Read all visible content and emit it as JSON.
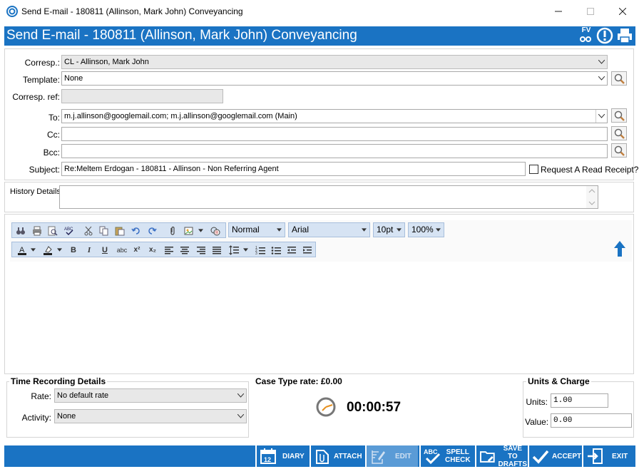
{
  "window": {
    "title": "Send E-mail - 180811 (Allinson, Mark John) Conveyancing",
    "minimize_icon": "minimize-icon",
    "maximize_icon": "maximize-icon",
    "close_icon": "close-icon"
  },
  "header": {
    "title": "Send E-mail - 180811 (Allinson, Mark John) Conveyancing",
    "fv_label": "FV",
    "accent": "#1a73c3"
  },
  "form": {
    "corresp_label": "Corresp.:",
    "corresp_value": "CL - Allinson, Mark John",
    "template_label": "Template:",
    "template_value": "None",
    "corresp_ref_label": "Corresp. ref:",
    "corresp_ref_value": "",
    "to_label": "To:",
    "to_value": "m.j.allinson@googlemail.com; m.j.allinson@googlemail.com (Main)",
    "cc_label": "Cc:",
    "cc_value": "",
    "bcc_label": "Bcc:",
    "bcc_value": "",
    "subject_label": "Subject:",
    "subject_value": "Re:Meltem Erdogan - 180811 - Allinson - Non Referring Agent",
    "read_receipt_label": "Request A Read Receipt?"
  },
  "history": {
    "label": "History Details:",
    "value": ""
  },
  "editor": {
    "style_value": "Normal",
    "font_value": "Arial",
    "size_value": "10pt",
    "zoom_value": "100%",
    "format_buttons": [
      "B",
      "I",
      "U",
      "abc",
      "x²",
      "x₂"
    ]
  },
  "time_recording": {
    "title": "Time Recording Details",
    "rate_label": "Rate:",
    "rate_value": "No default rate",
    "activity_label": "Activity:",
    "activity_value": "None"
  },
  "case_type": {
    "label": "Case Type rate: £0.00",
    "timer": "00:00:57"
  },
  "units_charge": {
    "title": "Units & Charge",
    "units_label": "Units:",
    "units_value": "1.00",
    "value_label": "Value:",
    "value_value": "0.00"
  },
  "buttons": {
    "diary": "DIARY",
    "attach": "ATTACH",
    "edit": "EDIT",
    "spell_check_1": "SPELL",
    "spell_check_2": "CHECK",
    "save_drafts_1": "SAVE TO",
    "save_drafts_2": "DRAFTS",
    "accept": "ACCEPT",
    "exit": "EXIT",
    "diary_icon_text": "12",
    "spell_icon_text": "ABC"
  }
}
